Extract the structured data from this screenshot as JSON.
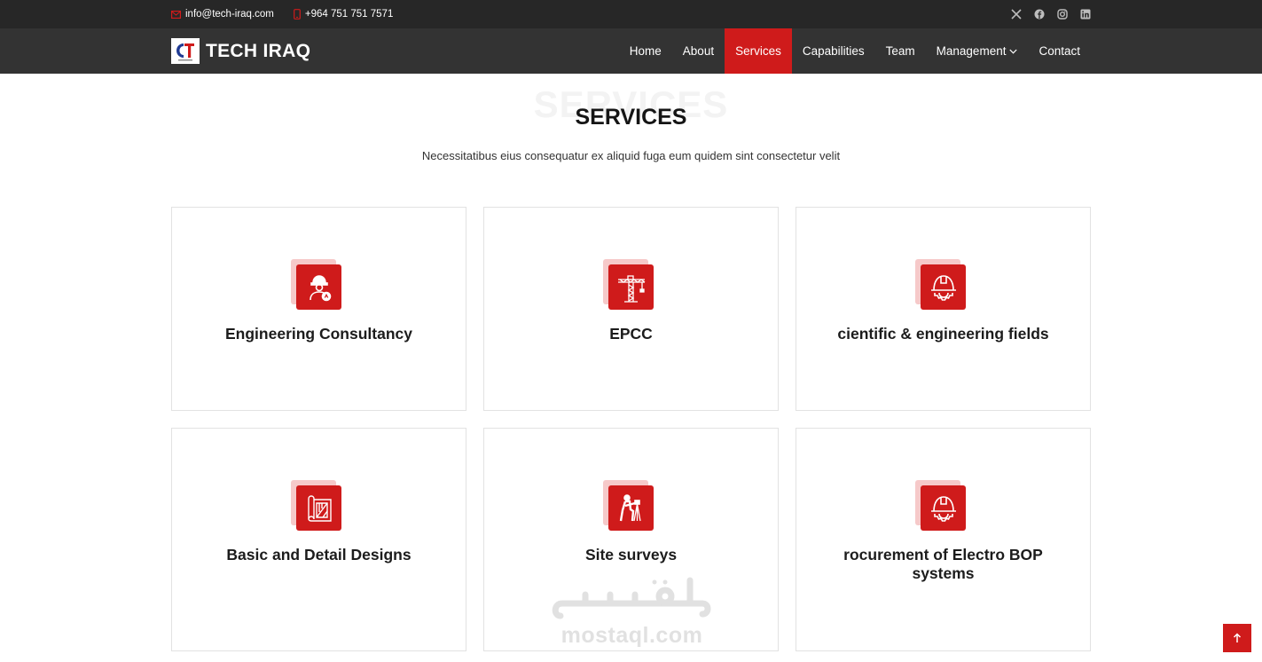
{
  "topbar": {
    "email": "info@tech-iraq.com",
    "phone": "+964 751 751 7571",
    "social_icons": [
      "x-twitter-icon",
      "facebook-icon",
      "instagram-icon",
      "linkedin-icon"
    ]
  },
  "header": {
    "brand": "TECH IRAQ",
    "nav": [
      {
        "label": "Home",
        "active": false
      },
      {
        "label": "About",
        "active": false
      },
      {
        "label": "Services",
        "active": true
      },
      {
        "label": "Capabilities",
        "active": false
      },
      {
        "label": "Team",
        "active": false
      },
      {
        "label": "Management",
        "active": false,
        "dropdown": true
      },
      {
        "label": "Contact",
        "active": false
      }
    ]
  },
  "section": {
    "bg_title": "SERVICES",
    "title": "SERVICES",
    "subtitle": "Necessitatibus eius consequatur ex aliquid fuga eum quidem sint consectetur velit"
  },
  "services": [
    {
      "title": "Engineering Consultancy",
      "icon": "engineer-icon"
    },
    {
      "title": "EPCC",
      "icon": "crane-icon"
    },
    {
      "title": "cientific & engineering fields",
      "icon": "hard-hat-gear-icon"
    },
    {
      "title": "Basic and Detail Designs",
      "icon": "blueprint-icon"
    },
    {
      "title": "Site surveys",
      "icon": "surveyor-icon"
    },
    {
      "title": "rocurement of Electro BOP systems",
      "icon": "hard-hat-gear-icon"
    }
  ],
  "watermark": {
    "latin": "mostaql.com"
  },
  "colors": {
    "accent": "#cf1b1b",
    "topbar": "#272727",
    "header": "#333333"
  }
}
